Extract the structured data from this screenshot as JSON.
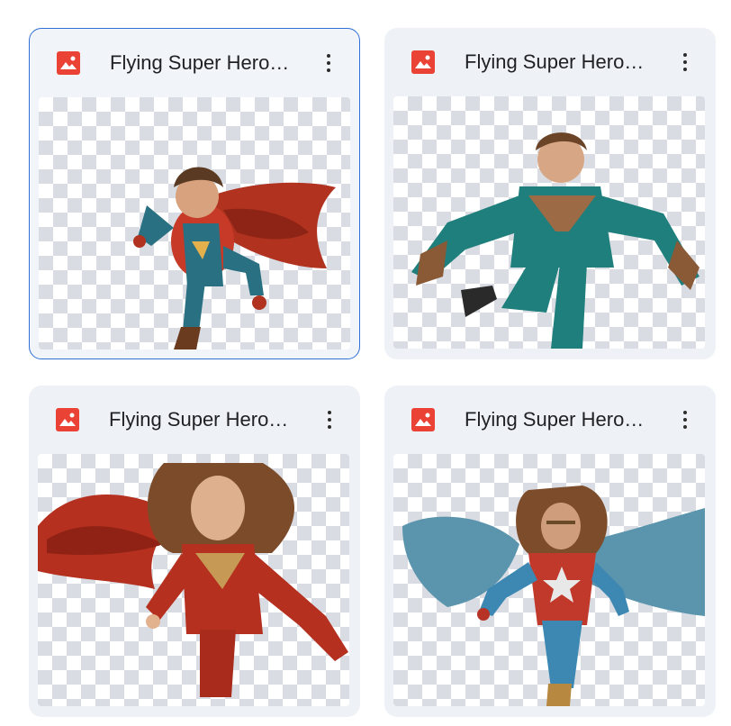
{
  "files": [
    {
      "name": "Flying Super Hero…",
      "icon": "image-file-icon",
      "selected": true
    },
    {
      "name": "Flying Super Hero…",
      "icon": "image-file-icon",
      "selected": false
    },
    {
      "name": "Flying Super Hero…",
      "icon": "image-file-icon",
      "selected": false
    },
    {
      "name": "Flying Super Hero…",
      "icon": "image-file-icon",
      "selected": false
    }
  ],
  "colors": {
    "icon_red": "#ea4335",
    "card_bg": "#eef2f7",
    "selected_border": "#2f6fd6"
  }
}
